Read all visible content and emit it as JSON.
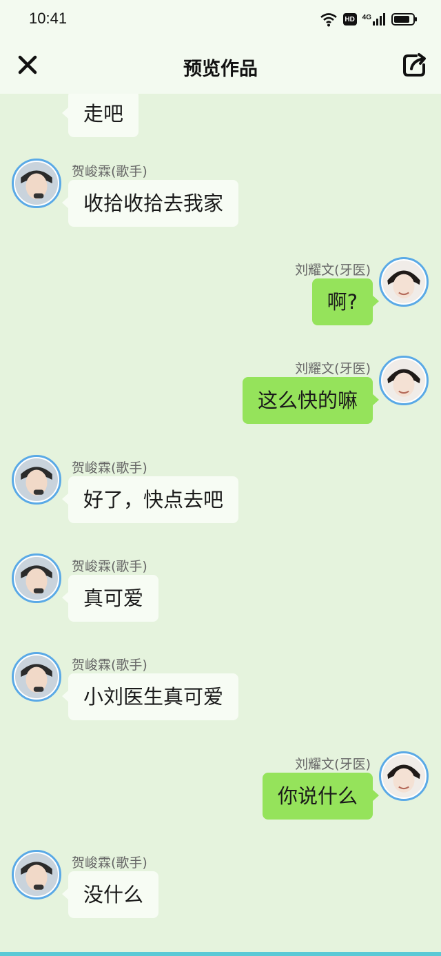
{
  "status": {
    "time": "10:41",
    "hd": "HD",
    "network": "4G",
    "battery_level": 0.85
  },
  "nav": {
    "title": "预览作品"
  },
  "messages": [
    {
      "side": "left",
      "name": "",
      "text": "走吧"
    },
    {
      "side": "left",
      "name": "贺峻霖(歌手)",
      "text": "收拾收拾去我家"
    },
    {
      "side": "right",
      "name": "刘耀文(牙医)",
      "text": "啊?"
    },
    {
      "side": "right",
      "name": "刘耀文(牙医)",
      "text": "这么快的嘛"
    },
    {
      "side": "left",
      "name": "贺峻霖(歌手)",
      "text": "好了，快点去吧"
    },
    {
      "side": "left",
      "name": "贺峻霖(歌手)",
      "text": "真可爱"
    },
    {
      "side": "left",
      "name": "贺峻霖(歌手)",
      "text": "小刘医生真可爱"
    },
    {
      "side": "right",
      "name": "刘耀文(牙医)",
      "text": "你说什么"
    },
    {
      "side": "left",
      "name": "贺峻霖(歌手)",
      "text": "没什么"
    }
  ],
  "colors": {
    "background": "#e5f3dd",
    "left_bubble": "#f7fcf4",
    "right_bubble": "#95e35b",
    "avatar_ring": "#5aa9e6"
  }
}
